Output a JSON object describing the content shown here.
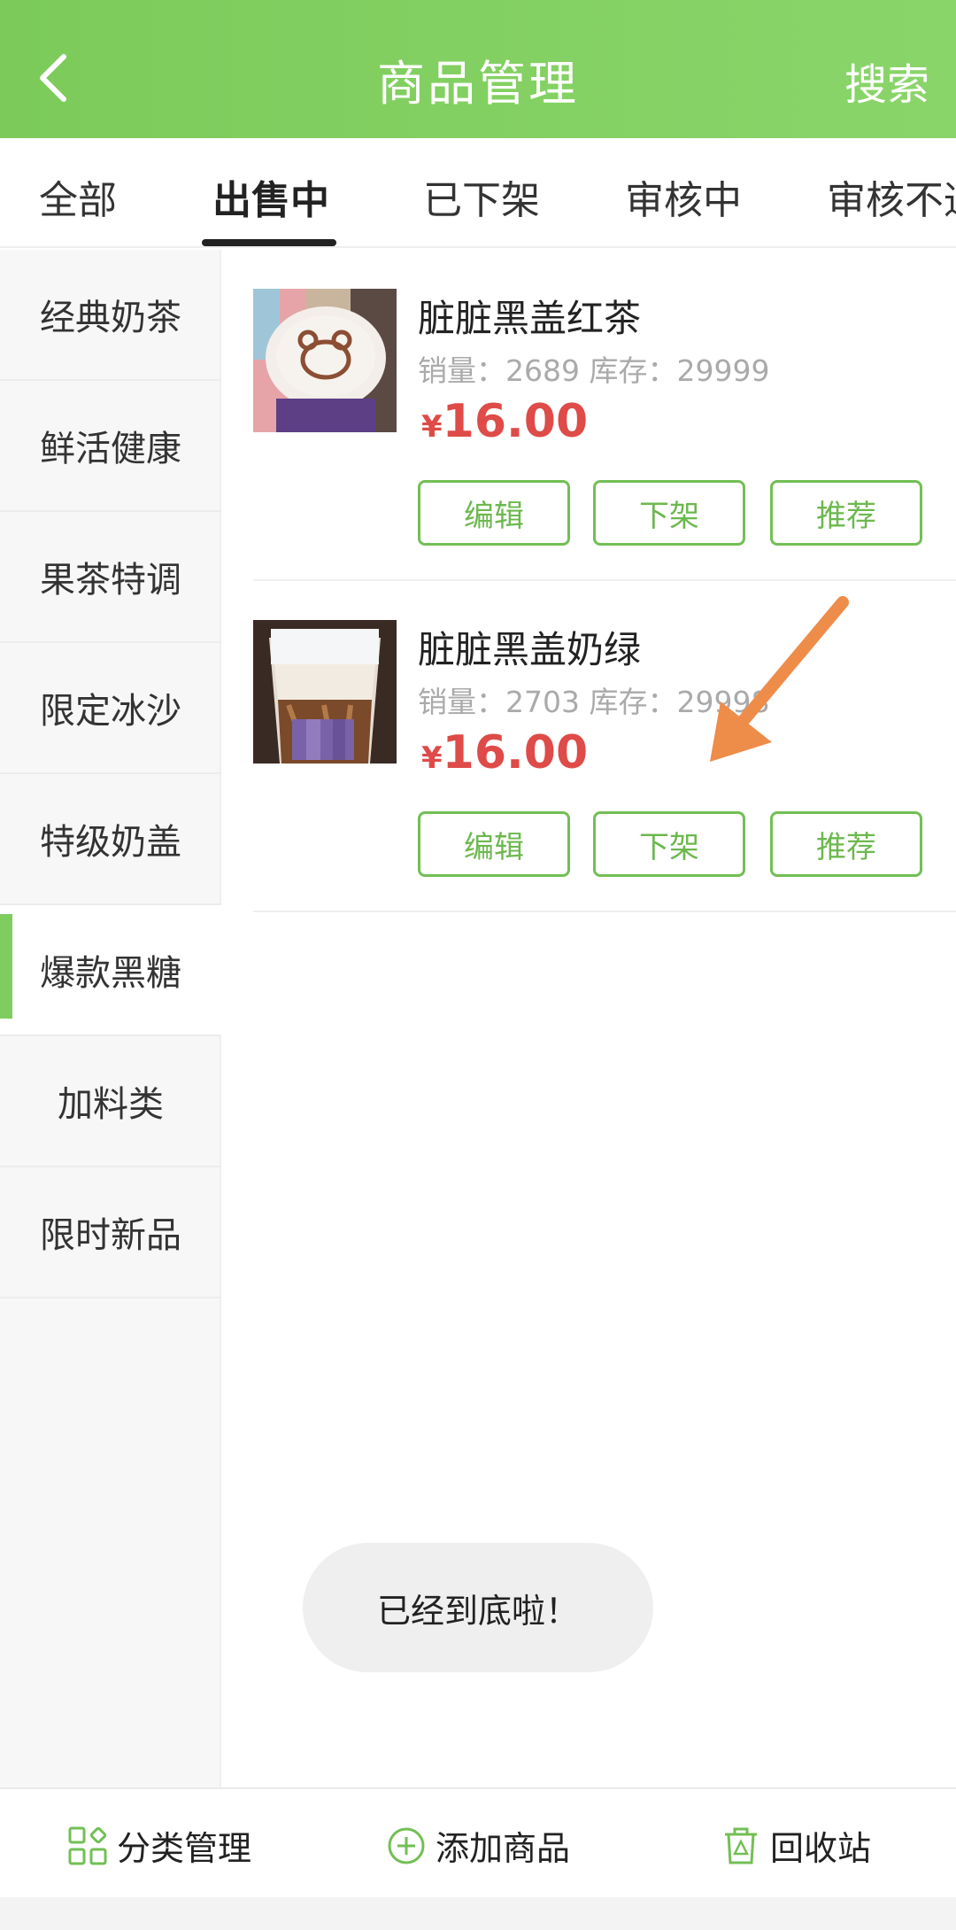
{
  "header": {
    "title": "商品管理",
    "search_label": "搜索"
  },
  "tabs": [
    {
      "label": "全部",
      "active": false
    },
    {
      "label": "出售中",
      "active": true
    },
    {
      "label": "已下架",
      "active": false
    },
    {
      "label": "审核中",
      "active": false
    },
    {
      "label": "审核不通过",
      "active": false
    }
  ],
  "categories": [
    {
      "label": "经典奶茶",
      "active": false
    },
    {
      "label": "鲜活健康",
      "active": false
    },
    {
      "label": "果茶特调",
      "active": false
    },
    {
      "label": "限定冰沙",
      "active": false
    },
    {
      "label": "特级奶盖",
      "active": false
    },
    {
      "label": "爆款黑糖",
      "active": true
    },
    {
      "label": "加料类",
      "active": false
    },
    {
      "label": "限时新品",
      "active": false
    }
  ],
  "products": [
    {
      "name": "脏脏黑盖红茶",
      "meta": "销量：2689 库存：29999",
      "currency": "¥",
      "price": "16.00",
      "buttons": {
        "edit": "编辑",
        "offshelf": "下架",
        "recommend": "推荐"
      }
    },
    {
      "name": "脏脏黑盖奶绿",
      "meta": "销量：2703 库存：29998",
      "currency": "¥",
      "price": "16.00",
      "buttons": {
        "edit": "编辑",
        "offshelf": "下架",
        "recommend": "推荐"
      }
    }
  ],
  "toast": "已经到底啦！",
  "bottom_bar": {
    "category_manage": "分类管理",
    "add_product": "添加商品",
    "recycle_bin": "回收站"
  },
  "colors": {
    "brand_green": "#7fcc5f",
    "price_red": "#de4b48",
    "annotation_orange": "#ee8c4a"
  },
  "icons": {
    "back": "chevron-left-icon",
    "category": "grid-icon",
    "add": "plus-circle-icon",
    "recycle": "trash-recycle-icon"
  }
}
